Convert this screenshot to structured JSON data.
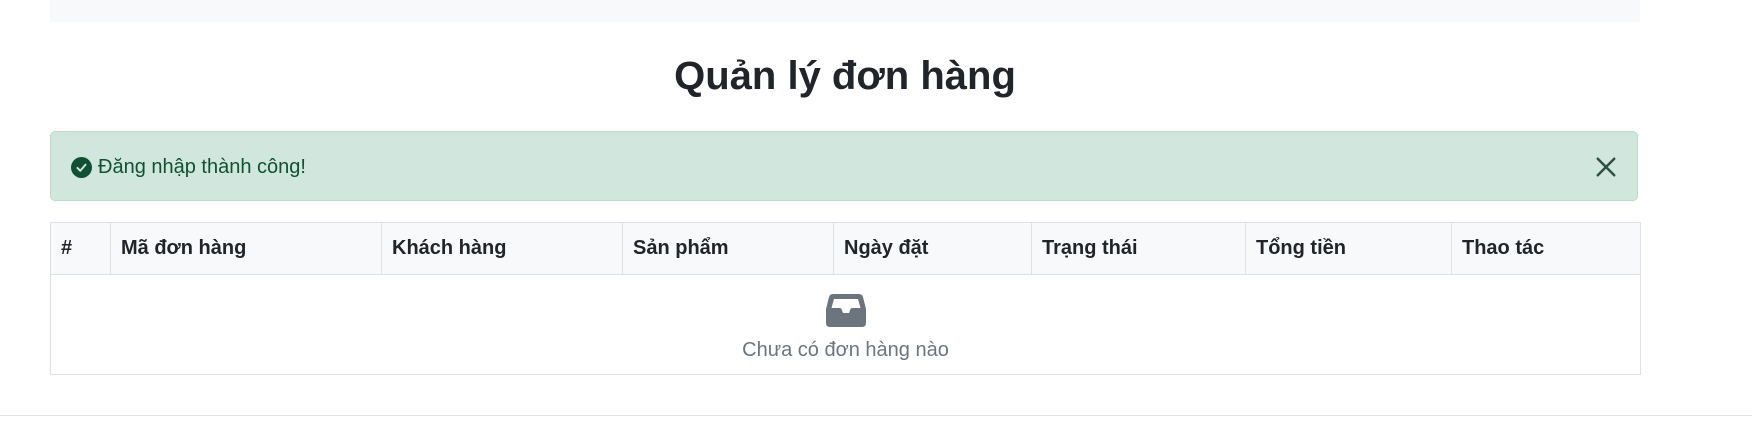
{
  "page": {
    "title": "Quản lý đơn hàng"
  },
  "alert": {
    "message": "Đăng nhập thành công!",
    "type": "success",
    "icon": "check-circle-icon",
    "close_icon": "close-icon",
    "bg_color": "#d1e7dd",
    "text_color": "#0f5132"
  },
  "table": {
    "columns": [
      "#",
      "Mã đơn hàng",
      "Khách hàng",
      "Sản phẩm",
      "Ngày đặt",
      "Trạng thái",
      "Tổng tiền",
      "Thao tác"
    ],
    "rows": [],
    "empty": {
      "icon": "inbox-icon",
      "message": "Chưa có đơn hàng nào"
    }
  },
  "colors": {
    "header_bg": "#f8f9fa",
    "border": "#dee2e6",
    "muted_text": "#6c757d"
  }
}
